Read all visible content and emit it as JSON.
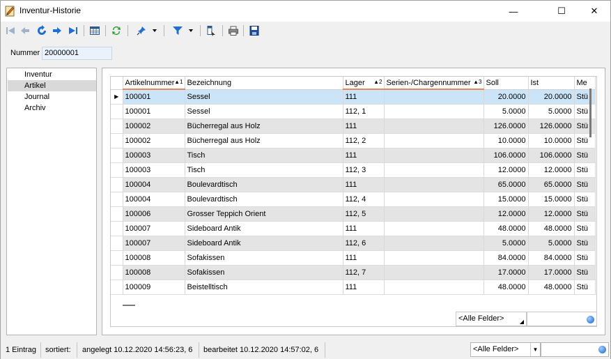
{
  "window": {
    "title": "Inventur-Historie",
    "minimize": "—",
    "maximize": "☐",
    "close": "✕"
  },
  "toolbar": {
    "icons": [
      "first-record-icon",
      "previous-record-icon",
      "refresh-record-icon",
      "next-record-icon",
      "last-record-icon",
      "table-view-icon",
      "reload-icon",
      "pin-icon",
      "filter-icon",
      "export-icon",
      "print-icon",
      "save-icon"
    ]
  },
  "form": {
    "nummer_label": "Nummer",
    "nummer_value": "20000001"
  },
  "nav": {
    "items": [
      {
        "label": "Inventur"
      },
      {
        "label": "Artikel"
      },
      {
        "label": "Journal"
      },
      {
        "label": "Archiv"
      }
    ],
    "selected": "Artikel"
  },
  "grid": {
    "columns": [
      {
        "label": "Artikelnummer",
        "sort": "1"
      },
      {
        "label": "Bezeichnung"
      },
      {
        "label": "Lager",
        "sort": "2"
      },
      {
        "label": "Serien-/Chargennummer",
        "sort": "3"
      },
      {
        "label": "Soll"
      },
      {
        "label": "Ist"
      },
      {
        "label": "Me"
      }
    ],
    "rows": [
      {
        "artikelnummer": "100001",
        "bezeichnung": "Sessel",
        "lager": "111",
        "serie": "",
        "soll": "20.0000",
        "ist": "20.0000",
        "me": "Stü"
      },
      {
        "artikelnummer": "100001",
        "bezeichnung": "Sessel",
        "lager": "112, 1",
        "serie": "",
        "soll": "5.0000",
        "ist": "5.0000",
        "me": "Stü"
      },
      {
        "artikelnummer": "100002",
        "bezeichnung": "Bücherregal aus Holz",
        "lager": "111",
        "serie": "",
        "soll": "126.0000",
        "ist": "126.0000",
        "me": "Stü"
      },
      {
        "artikelnummer": "100002",
        "bezeichnung": "Bücherregal aus Holz",
        "lager": "112, 2",
        "serie": "",
        "soll": "10.0000",
        "ist": "10.0000",
        "me": "Stü"
      },
      {
        "artikelnummer": "100003",
        "bezeichnung": "Tisch",
        "lager": "111",
        "serie": "",
        "soll": "106.0000",
        "ist": "106.0000",
        "me": "Stü"
      },
      {
        "artikelnummer": "100003",
        "bezeichnung": "Tisch",
        "lager": "112, 3",
        "serie": "",
        "soll": "12.0000",
        "ist": "12.0000",
        "me": "Stü"
      },
      {
        "artikelnummer": "100004",
        "bezeichnung": "Boulevardtisch",
        "lager": "111",
        "serie": "",
        "soll": "65.0000",
        "ist": "65.0000",
        "me": "Stü"
      },
      {
        "artikelnummer": "100004",
        "bezeichnung": "Boulevardtisch",
        "lager": "112, 4",
        "serie": "",
        "soll": "15.0000",
        "ist": "15.0000",
        "me": "Stü"
      },
      {
        "artikelnummer": "100006",
        "bezeichnung": "Grosser Teppich Orient",
        "lager": "112, 5",
        "serie": "",
        "soll": "12.0000",
        "ist": "12.0000",
        "me": "Stü"
      },
      {
        "artikelnummer": "100007",
        "bezeichnung": "Sideboard Antik",
        "lager": "111",
        "serie": "",
        "soll": "48.0000",
        "ist": "48.0000",
        "me": "Stü"
      },
      {
        "artikelnummer": "100007",
        "bezeichnung": "Sideboard Antik",
        "lager": "112, 6",
        "serie": "",
        "soll": "5.0000",
        "ist": "5.0000",
        "me": "Stü"
      },
      {
        "artikelnummer": "100008",
        "bezeichnung": "Sofakissen",
        "lager": "111",
        "serie": "",
        "soll": "84.0000",
        "ist": "84.0000",
        "me": "Stü"
      },
      {
        "artikelnummer": "100008",
        "bezeichnung": "Sofakissen",
        "lager": "112, 7",
        "serie": "",
        "soll": "17.0000",
        "ist": "17.0000",
        "me": "Stü"
      },
      {
        "artikelnummer": "100009",
        "bezeichnung": "Beistelltisch",
        "lager": "111",
        "serie": "",
        "soll": "48.0000",
        "ist": "48.0000",
        "me": "Stü"
      }
    ],
    "selected_row": 0,
    "filter_value": "<Alle Felder>"
  },
  "status": {
    "count": "1 Eintrag",
    "sorted": "sortiert:",
    "created": "angelegt 10.12.2020 14:56:23,  6",
    "edited": "bearbeitet 10.12.2020 14:57:02,  6",
    "filter_value": "<Alle Felder>"
  },
  "colors": {
    "selected_row": "#cce4f7",
    "alt_row": "#e4e4e4",
    "sort_underline": "#e8875b",
    "nav_selected": "#d9d9d9"
  }
}
